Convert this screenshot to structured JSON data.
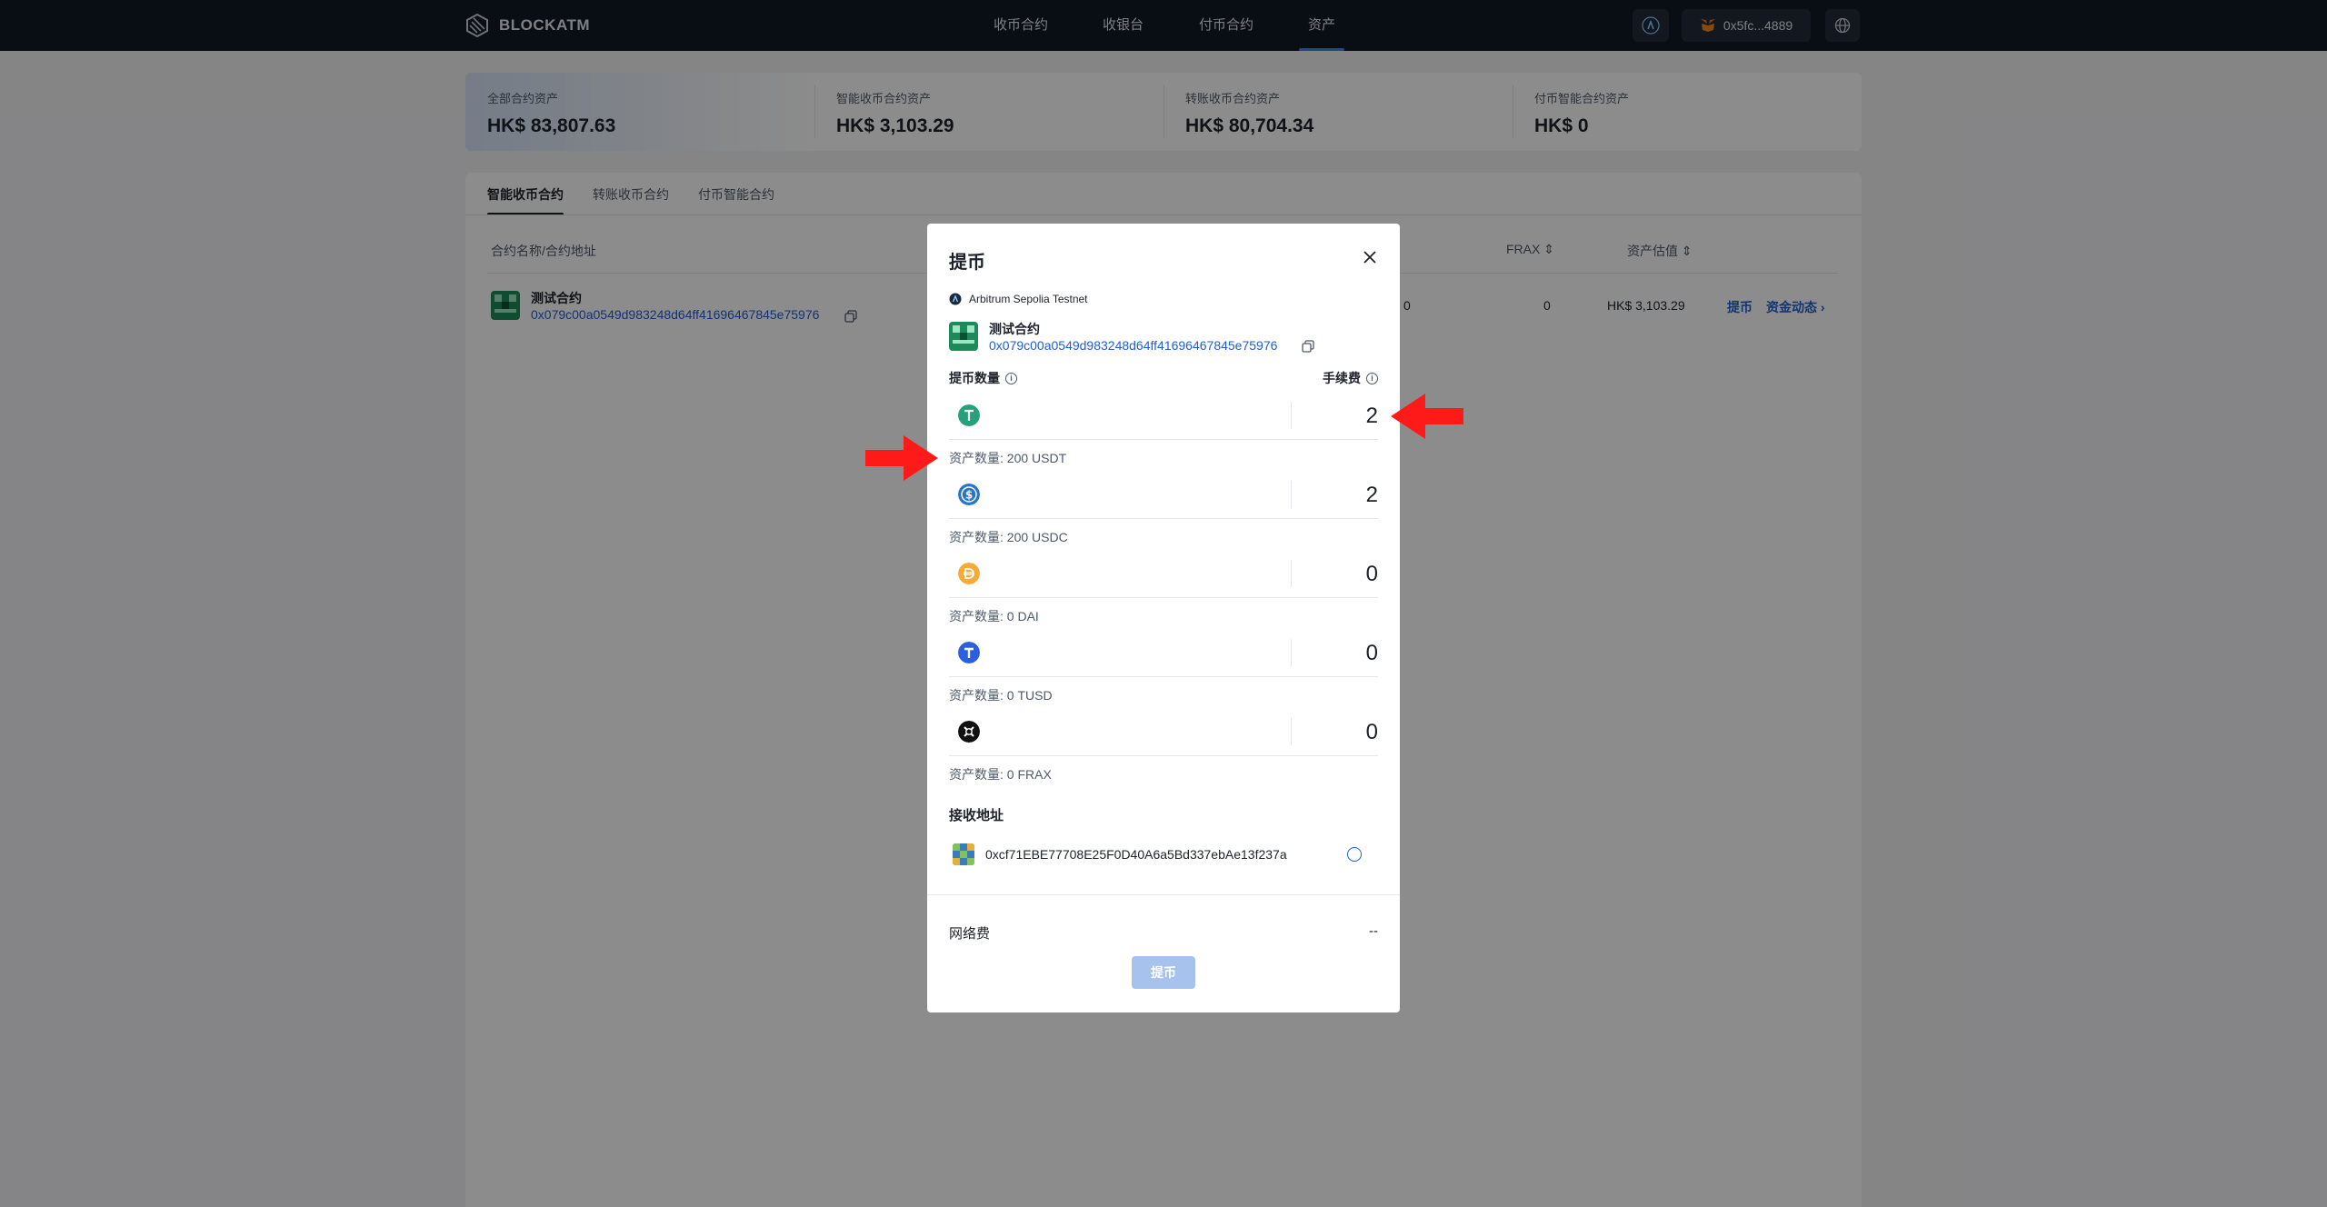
{
  "brand": "BLOCKATM",
  "nav": [
    "收币合约",
    "收银台",
    "付币合约",
    "资产"
  ],
  "nav_active": "资产",
  "wallet": "0x5fc...4889",
  "summary": [
    {
      "label": "全部合约资产",
      "value": "HK$ 83,807.63"
    },
    {
      "label": "智能收币合约资产",
      "value": "HK$ 3,103.29"
    },
    {
      "label": "转账收币合约资产",
      "value": "HK$ 80,704.34"
    },
    {
      "label": "付币智能合约资产",
      "value": "HK$ 0"
    }
  ],
  "tabs": [
    "智能收币合约",
    "转账收币合约",
    "付币智能合约"
  ],
  "table": {
    "headers": [
      "合约名称/合约地址",
      "FRAX",
      "资产估值"
    ],
    "row": {
      "name": "测试合约",
      "address": "0x079c00a0549d983248d64ff41696467845e75976",
      "partial_value": "0",
      "frax": "0",
      "valuation": "HK$ 3,103.29",
      "withdraw": "提币",
      "activity": "资金动态"
    }
  },
  "modal": {
    "title": "提币",
    "network": "Arbitrum Sepolia Testnet",
    "contract_name": "测试合约",
    "contract_address": "0x079c00a0549d983248d64ff41696467845e75976",
    "amount_label": "提币数量",
    "fee_label": "手续费",
    "coins": [
      {
        "symbol": "USDT",
        "fee": "2",
        "balance": "资产数量: 200 USDT",
        "color": "#26a17b",
        "icon": "usdt-icon"
      },
      {
        "symbol": "USDC",
        "fee": "2",
        "balance": "资产数量: 200 USDC",
        "color": "#2775ca",
        "icon": "usdc-icon"
      },
      {
        "symbol": "DAI",
        "fee": "0",
        "balance": "资产数量: 0 DAI",
        "color": "#f5ac37",
        "icon": "dai-icon"
      },
      {
        "symbol": "TUSD",
        "fee": "0",
        "balance": "资产数量: 0 TUSD",
        "color": "#2b5fe0",
        "icon": "tusd-icon"
      },
      {
        "symbol": "FRAX",
        "fee": "0",
        "balance": "资产数量: 0 FRAX",
        "color": "#111111",
        "icon": "frax-icon"
      }
    ],
    "receive_label": "接收地址",
    "receive_address": "0xcf71EBE77708E25F0D40A6a5Bd337ebAe13f237a",
    "network_fee_label": "网络费",
    "network_fee_value": "--",
    "submit": "提币"
  },
  "colors": {
    "accent": "#1f5fd1",
    "annotation_arrow": "#ff1a1a",
    "topbar": "#121826"
  }
}
